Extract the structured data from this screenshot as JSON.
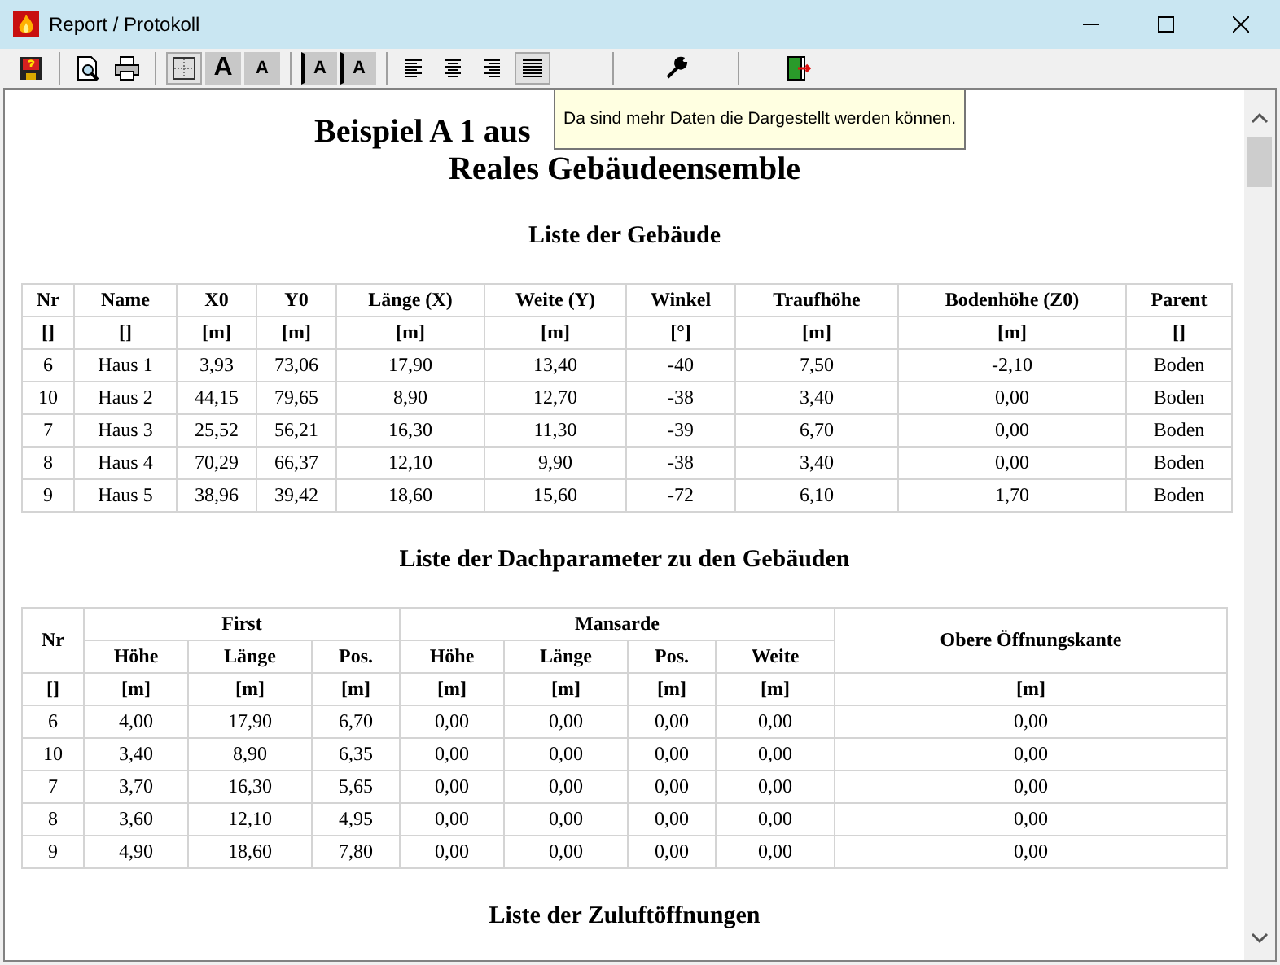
{
  "window": {
    "title": "Report / Protokoll"
  },
  "toolbar": [
    [
      {
        "kind": "save",
        "pressed": false
      }
    ],
    [
      {
        "kind": "preview",
        "pressed": false
      },
      {
        "kind": "print",
        "pressed": false
      }
    ],
    [
      {
        "kind": "grid",
        "pressed": true
      },
      {
        "kind": "font-bigger",
        "label": "A",
        "pressed": false
      },
      {
        "kind": "font-smaller",
        "label": "A",
        "pressed": false
      }
    ],
    [
      {
        "kind": "margin-left",
        "label": "A",
        "pressed": false
      },
      {
        "kind": "margin-right",
        "label": "A",
        "pressed": false
      }
    ],
    [
      {
        "kind": "align-left",
        "pressed": false
      },
      {
        "kind": "align-center",
        "pressed": false
      },
      {
        "kind": "align-right",
        "pressed": false
      },
      {
        "kind": "justify",
        "pressed": true
      }
    ],
    [
      {
        "kind": "settings",
        "pressed": false
      }
    ],
    [
      {
        "kind": "exit",
        "pressed": false
      }
    ]
  ],
  "tooltip": {
    "text": "Da sind mehr Daten die Dargestellt werden können."
  },
  "report": {
    "title_lines": [
      "Beispiel A 1 aus",
      "Reales Gebäudeensemble"
    ],
    "sections": [
      {
        "heading": "Liste der Gebäude",
        "table": {
          "kind": "simple",
          "columns": [
            {
              "label": "Nr",
              "unit": "[]"
            },
            {
              "label": "Name",
              "unit": "[]"
            },
            {
              "label": "X0",
              "unit": "[m]"
            },
            {
              "label": "Y0",
              "unit": "[m]"
            },
            {
              "label": "Länge (X)",
              "unit": "[m]"
            },
            {
              "label": "Weite (Y)",
              "unit": "[m]"
            },
            {
              "label": "Winkel",
              "unit": "[°]"
            },
            {
              "label": "Traufhöhe",
              "unit": "[m]"
            },
            {
              "label": "Bodenhöhe (Z0)",
              "unit": "[m]"
            },
            {
              "label": "Parent",
              "unit": "[]"
            }
          ],
          "rows": [
            [
              "6",
              "Haus 1",
              "3,93",
              "73,06",
              "17,90",
              "13,40",
              "-40",
              "7,50",
              "-2,10",
              "Boden"
            ],
            [
              "10",
              "Haus 2",
              "44,15",
              "79,65",
              "8,90",
              "12,70",
              "-38",
              "3,40",
              "0,00",
              "Boden"
            ],
            [
              "7",
              "Haus 3",
              "25,52",
              "56,21",
              "16,30",
              "11,30",
              "-39",
              "6,70",
              "0,00",
              "Boden"
            ],
            [
              "8",
              "Haus 4",
              "70,29",
              "66,37",
              "12,10",
              "9,90",
              "-38",
              "3,40",
              "0,00",
              "Boden"
            ],
            [
              "9",
              "Haus 5",
              "38,96",
              "39,42",
              "18,60",
              "15,60",
              "-72",
              "6,10",
              "1,70",
              "Boden"
            ]
          ]
        }
      },
      {
        "heading": "Liste der Dachparameter zu den Gebäuden",
        "table": {
          "kind": "grouped",
          "lead": "Nr",
          "groups": [
            {
              "label": "First",
              "columns": [
                "Höhe",
                "Länge",
                "Pos."
              ]
            },
            {
              "label": "Mansarde",
              "columns": [
                "Höhe",
                "Länge",
                "Pos.",
                "Weite"
              ]
            }
          ],
          "tail": "Obere Öffnungskante",
          "units": [
            "[]",
            "[m]",
            "[m]",
            "[m]",
            "[m]",
            "[m]",
            "[m]",
            "[m]",
            "[m]"
          ],
          "rows": [
            [
              "6",
              "4,00",
              "17,90",
              "6,70",
              "0,00",
              "0,00",
              "0,00",
              "0,00",
              "0,00"
            ],
            [
              "10",
              "3,40",
              "8,90",
              "6,35",
              "0,00",
              "0,00",
              "0,00",
              "0,00",
              "0,00"
            ],
            [
              "7",
              "3,70",
              "16,30",
              "5,65",
              "0,00",
              "0,00",
              "0,00",
              "0,00",
              "0,00"
            ],
            [
              "8",
              "3,60",
              "12,10",
              "4,95",
              "0,00",
              "0,00",
              "0,00",
              "0,00",
              "0,00"
            ],
            [
              "9",
              "4,90",
              "18,60",
              "7,80",
              "0,00",
              "0,00",
              "0,00",
              "0,00",
              "0,00"
            ]
          ]
        }
      },
      {
        "heading": "Liste der Zuluftöffnungen"
      }
    ]
  }
}
